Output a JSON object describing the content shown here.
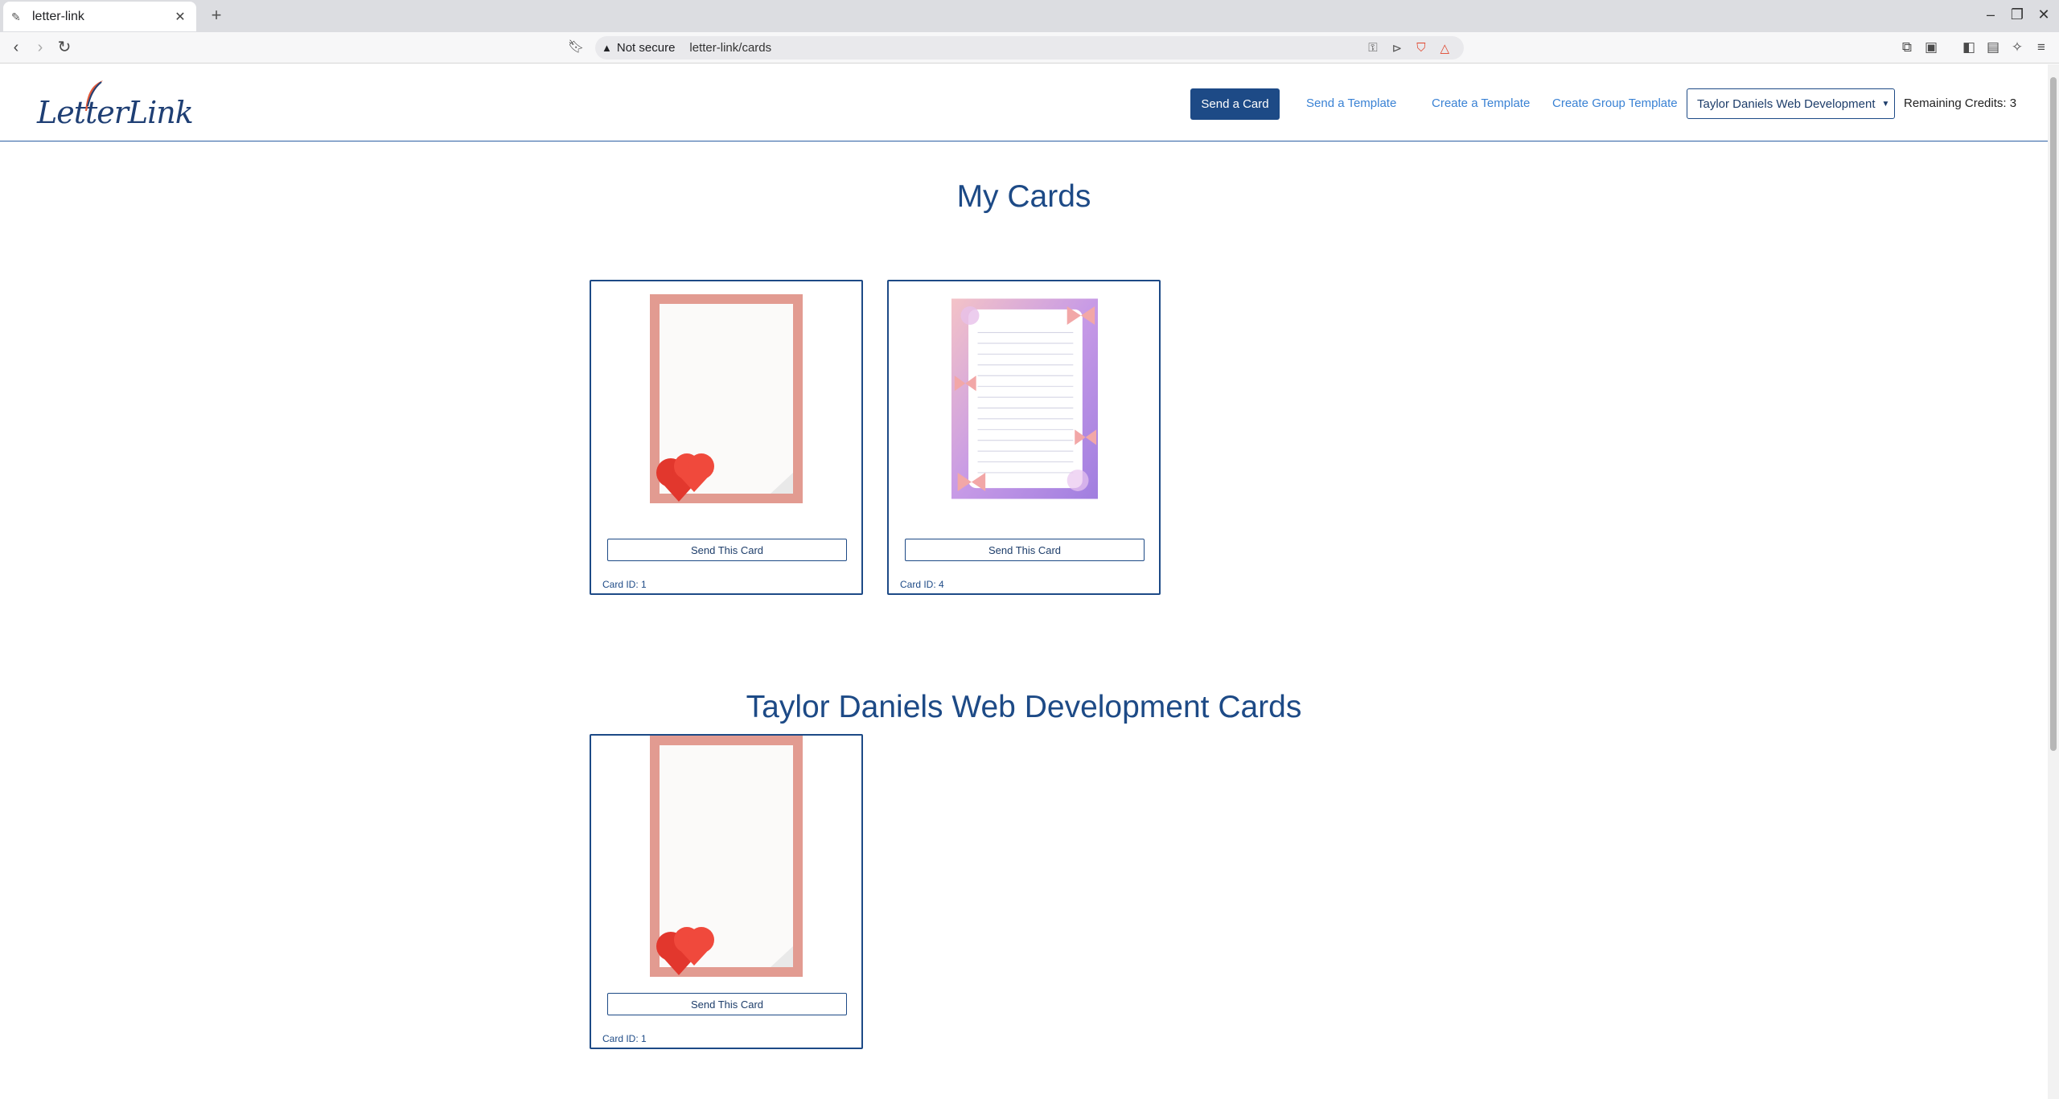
{
  "browser": {
    "tab_title": "letter-link",
    "security_label": "Not secure",
    "url": "letter-link/cards"
  },
  "nav": {
    "logo_text": "LetterLink",
    "send_card": "Send a Card",
    "send_template": "Send a Template",
    "create_template": "Create a Template",
    "create_group_template": "Create Group Template",
    "group_selector": "Taylor Daniels Web Development",
    "credits": "Remaining Credits: 3"
  },
  "sections": [
    {
      "title": "My Cards",
      "cards": [
        {
          "image": "hearts-card",
          "button": "Send This Card",
          "card_id": "Card ID: 1"
        },
        {
          "image": "bows-card",
          "button": "Send This Card",
          "card_id": "Card ID: 4"
        }
      ]
    },
    {
      "title": "Taylor Daniels Web Development Cards",
      "cards": [
        {
          "image": "hearts-card",
          "button": "Send This Card",
          "card_id": "Card ID: 1"
        }
      ]
    }
  ],
  "colors": {
    "primary": "#1d4a86",
    "link": "#3a82d4",
    "card_border_pink": "#e29b91",
    "bow_pink": "#f2a7a7",
    "bow_purple": "#b48be0"
  }
}
